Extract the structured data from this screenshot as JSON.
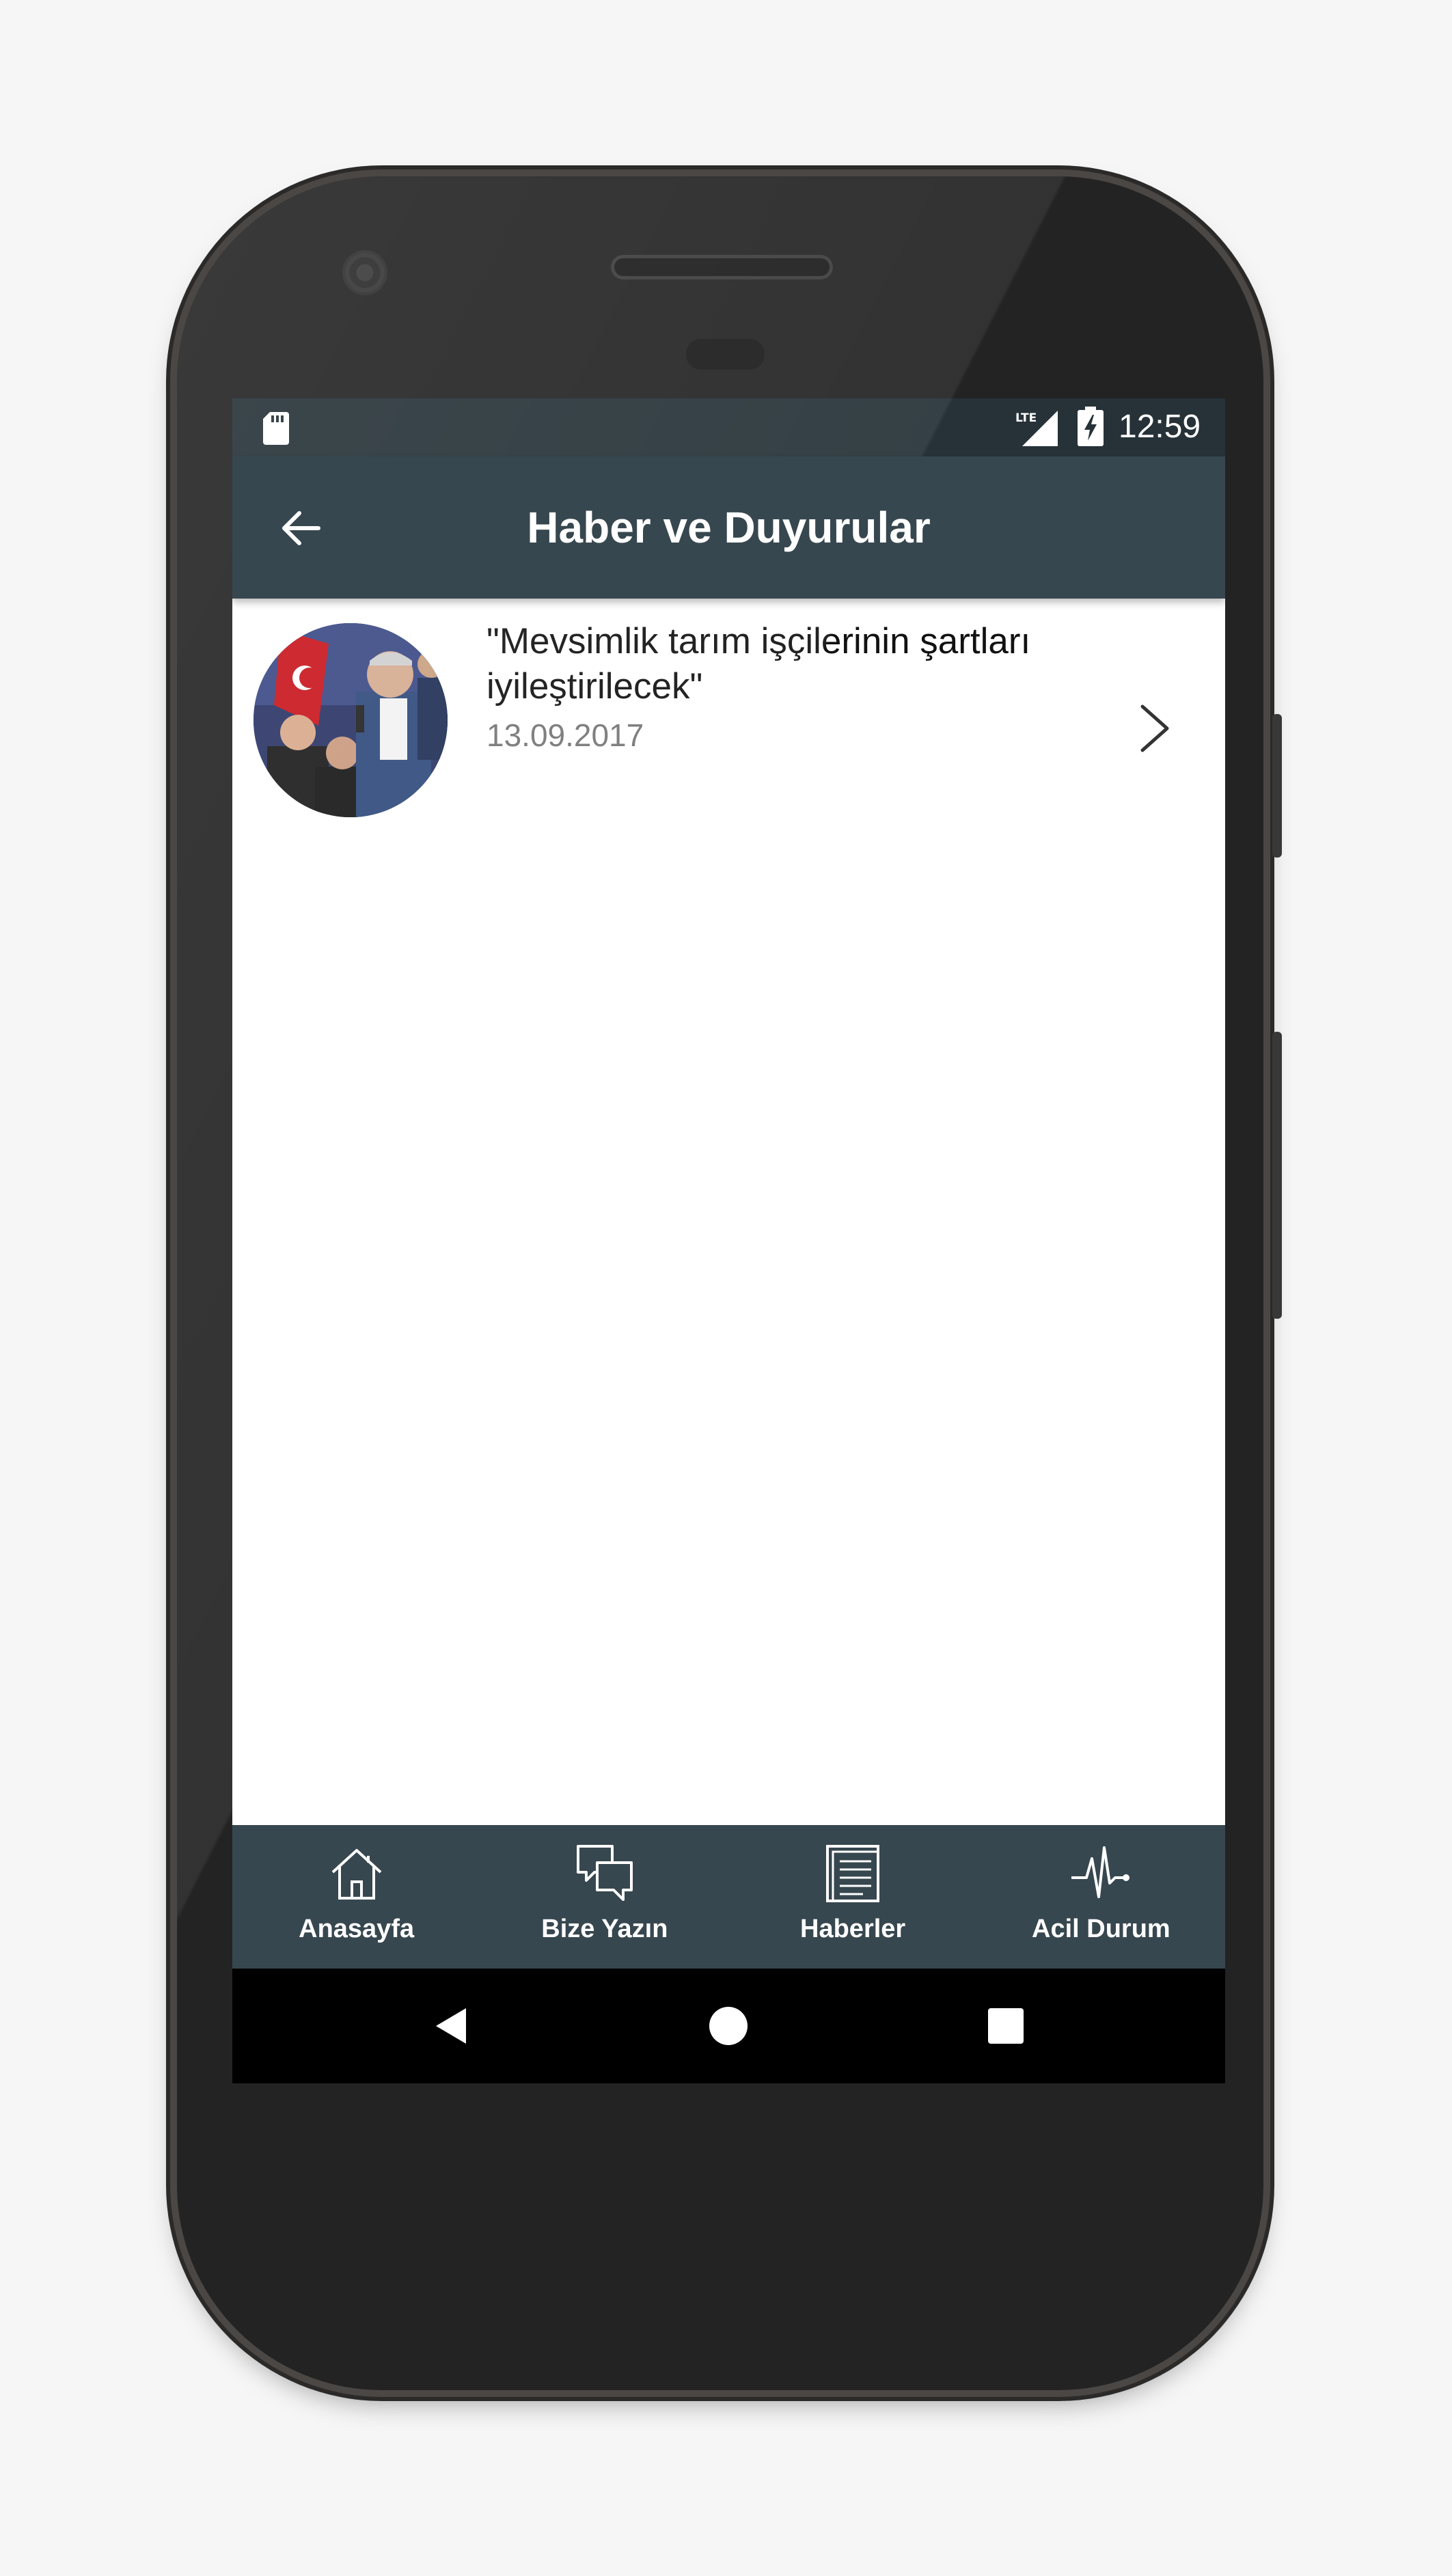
{
  "status_bar": {
    "network": "LTE",
    "time": "12:59"
  },
  "app_bar": {
    "title": "Haber ve Duyurular",
    "back_icon": "arrow-back-icon"
  },
  "news": [
    {
      "title": "\"Mevsimlik tarım işçilerinin şartları iyileştirilecek\"",
      "date": "13.09.2017"
    }
  ],
  "bottom_nav": {
    "items": [
      {
        "label": "Anasayfa",
        "icon": "home-icon"
      },
      {
        "label": "Bize Yazın",
        "icon": "chat-bubbles-icon"
      },
      {
        "label": "Haberler",
        "icon": "newspaper-icon"
      },
      {
        "label": "Acil Durum",
        "icon": "heartbeat-icon"
      }
    ],
    "background": "#37474f"
  },
  "colors": {
    "status_bar": "#263238",
    "app_bar": "#37474f",
    "date_text": "#757575"
  }
}
